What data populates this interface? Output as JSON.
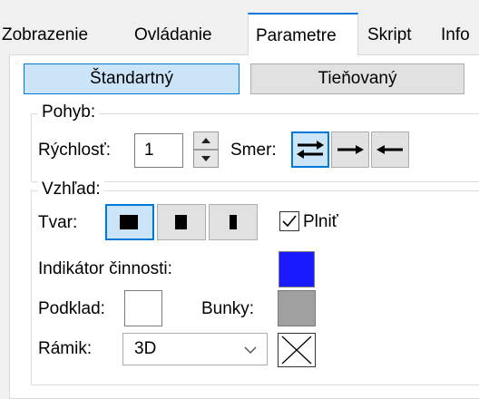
{
  "tabs": [
    {
      "label": "Zobrazenie",
      "active": false
    },
    {
      "label": "Ovládanie",
      "active": false
    },
    {
      "label": "Parametre",
      "active": true
    },
    {
      "label": "Skript",
      "active": false
    },
    {
      "label": "Info",
      "active": false
    }
  ],
  "modes": {
    "standard": {
      "label": "Štandartný",
      "selected": true
    },
    "shaded": {
      "label": "Tieňovaný",
      "selected": false
    }
  },
  "motion": {
    "title": "Pohyb:",
    "speed_label": "Rýchlosť:",
    "speed_value": "1",
    "direction_label": "Smer:",
    "directions": [
      {
        "icon": "bidirectional-arrows-icon",
        "selected": true
      },
      {
        "icon": "arrow-right-icon",
        "selected": false
      },
      {
        "icon": "arrow-left-icon",
        "selected": false
      }
    ]
  },
  "appearance": {
    "title": "Vzhľad:",
    "shape_label": "Tvar:",
    "shapes": [
      {
        "icon": "wide-block-icon",
        "selected": true
      },
      {
        "icon": "medium-block-icon",
        "selected": false
      },
      {
        "icon": "narrow-block-icon",
        "selected": false
      }
    ],
    "fill_label": "Plniť",
    "fill_checked": true,
    "activity_label": "Indikátor činnosti:",
    "activity_color": "#1a1aff",
    "background_label": "Podklad:",
    "background_color": "#ffffff",
    "cells_label": "Bunky:",
    "cells_color": "#a0a0a0",
    "frame_label": "Rámik:",
    "frame_value": "3D"
  },
  "colors": {
    "accent": "#0078d7",
    "selected_fill": "#cce4f7"
  }
}
